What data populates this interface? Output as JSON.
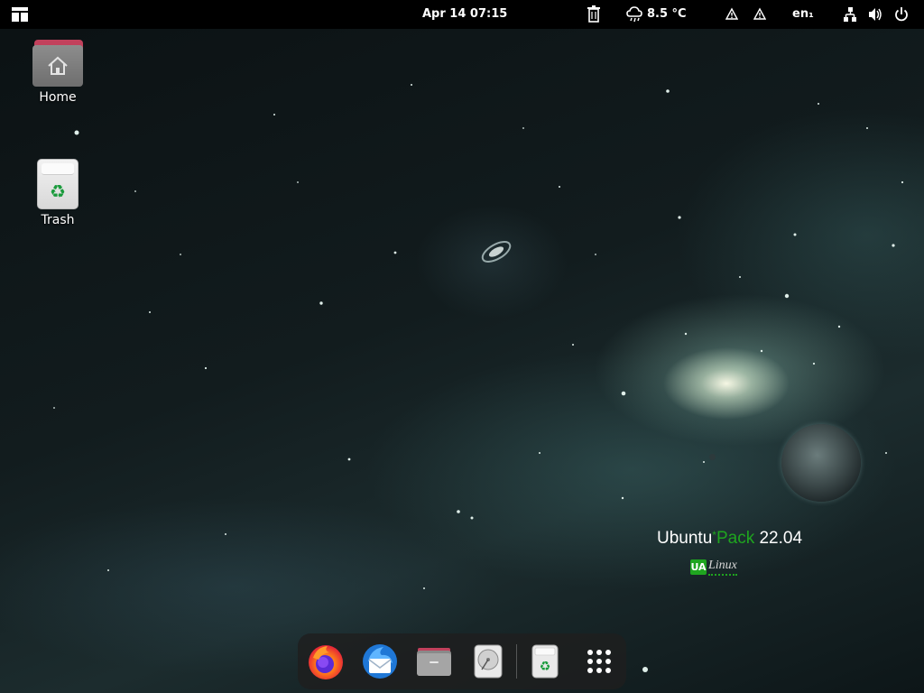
{
  "topbar": {
    "activities_icon": "activities-layout-icon",
    "clock": "Apr 14  07:15",
    "clipboard_icon": "clipboard-trash-icon",
    "weather_icon": "cloud-rain-icon",
    "temperature": "8.5 °C",
    "warnings": [
      "warning-icon",
      "warning-icon"
    ],
    "language": "en₁",
    "network_icon": "wired-network-icon",
    "volume_icon": "speaker-volume-icon",
    "power_icon": "power-icon"
  },
  "desktop": {
    "icons": [
      {
        "label": "Home",
        "icon": "home-folder-icon"
      },
      {
        "label": "Trash",
        "icon": "trash-icon"
      }
    ]
  },
  "branding": {
    "part1": "Ubuntu",
    "asterisk": "*",
    "part2": "Pack",
    "version": " 22.04",
    "ua": "UA",
    "linux": "Linux"
  },
  "dock": {
    "items": [
      {
        "name": "firefox",
        "icon": "firefox-icon"
      },
      {
        "name": "thunderbird",
        "icon": "thunderbird-icon"
      },
      {
        "name": "files",
        "icon": "files-folder-icon"
      },
      {
        "name": "disk-usage",
        "icon": "disk-drive-icon"
      },
      {
        "name": "trash",
        "icon": "trash-icon"
      },
      {
        "name": "show-applications",
        "icon": "app-grid-icon"
      }
    ]
  },
  "colors": {
    "accent_green": "#1fa51f",
    "folder_tab": "#c2415c",
    "topbar_bg": "#000000"
  }
}
